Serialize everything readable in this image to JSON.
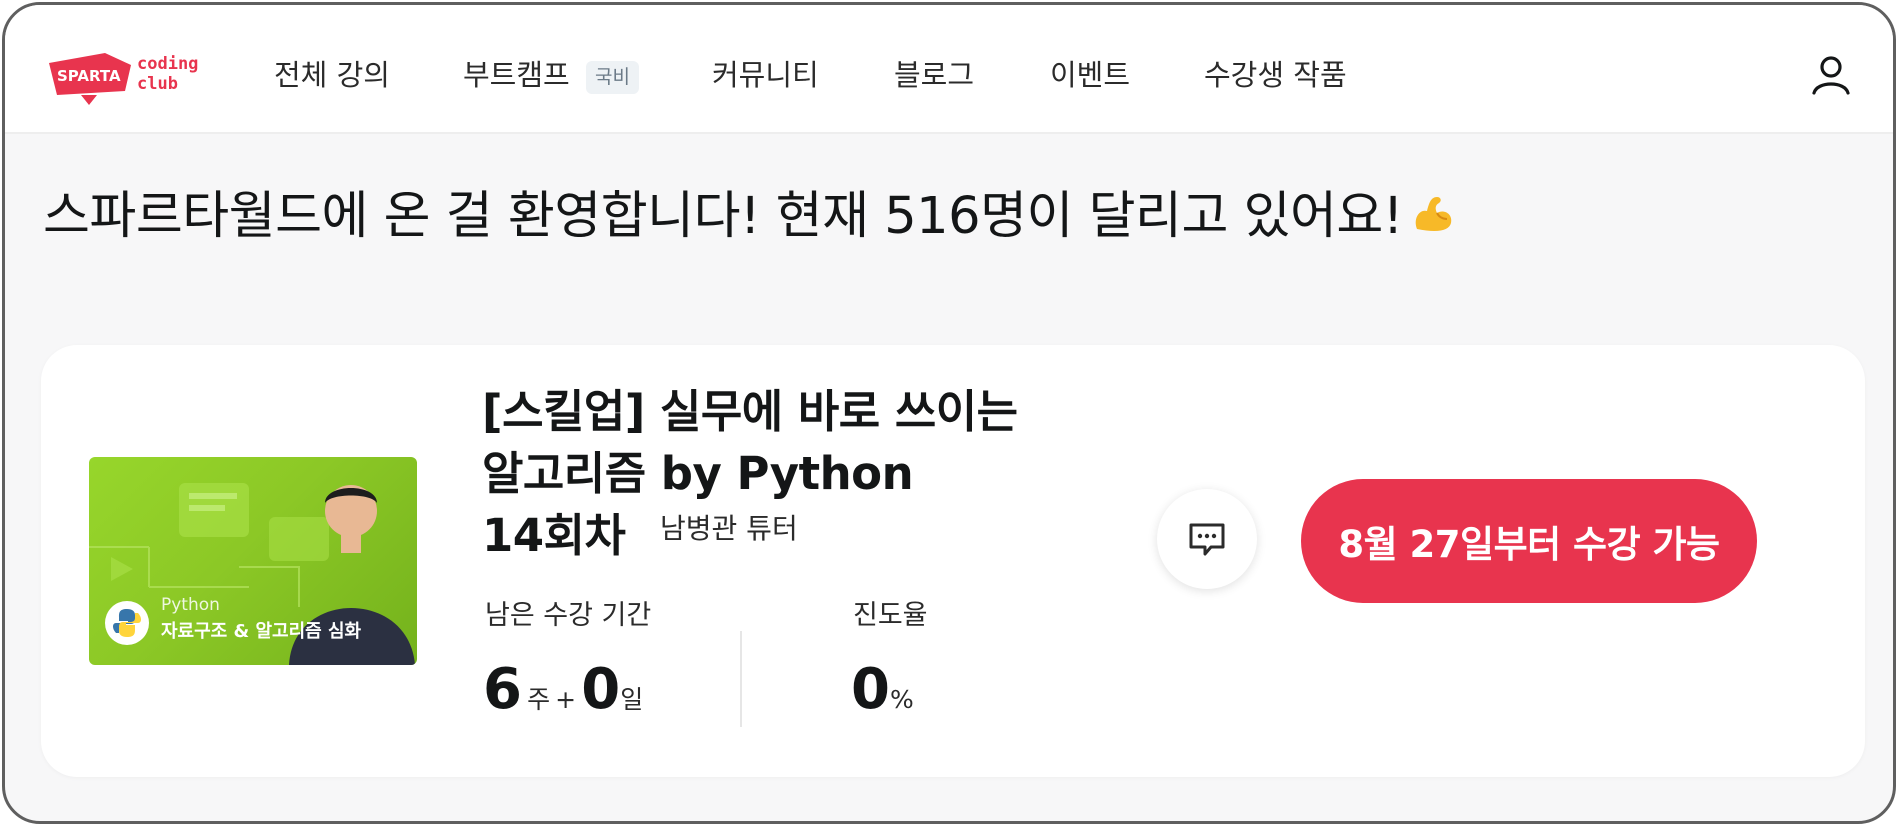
{
  "brand": {
    "logo_text_main": "SPARTA",
    "logo_text_sub1": "coding",
    "logo_text_sub2": "club"
  },
  "nav": {
    "items": [
      "전체 강의",
      "부트캠프",
      "커뮤니티",
      "블로그",
      "이벤트",
      "수강생 작품"
    ],
    "bootcamp_badge": "국비"
  },
  "welcome": {
    "text": "스파르타월드에 온 걸 환영합니다! 현재 516명이 달리고 있어요!"
  },
  "course": {
    "thumbnail_small": "Python",
    "thumbnail_label": "자료구조 & 알고리즘 심화",
    "title_line1": "[스킬업] 실무에 바로 쓰이는",
    "title_line2": "알고리즘 by Python",
    "title_line3": "14회차",
    "tutor": "남병관 튜터",
    "remaining_label": "남은 수강 기간",
    "remaining_weeks": "6",
    "weeks_unit": "주",
    "plus": "+",
    "remaining_days": "0",
    "days_unit": "일",
    "progress_label": "진도율",
    "progress_value": "0",
    "progress_unit": "%",
    "cta_label": "8월 27일부터 수강 가능"
  },
  "colors": {
    "brand_red": "#e8344e",
    "thumbnail_green": "#8cc826"
  },
  "icons": {
    "user": "user-icon",
    "chat": "chat-icon",
    "emoji": "flexed-biceps-icon"
  }
}
